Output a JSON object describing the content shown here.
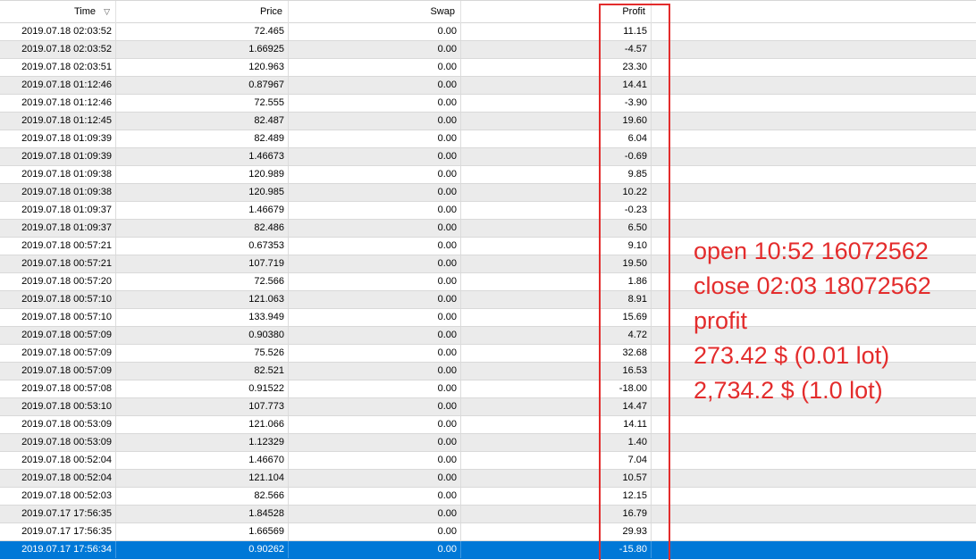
{
  "columns": {
    "time": "Time",
    "price": "Price",
    "swap": "Swap",
    "profit": "Profit",
    "sort_icon": "▽"
  },
  "rows": [
    {
      "time": "2019.07.18 02:03:52",
      "price": "72.465",
      "swap": "0.00",
      "profit": "11.15"
    },
    {
      "time": "2019.07.18 02:03:52",
      "price": "1.66925",
      "swap": "0.00",
      "profit": "-4.57"
    },
    {
      "time": "2019.07.18 02:03:51",
      "price": "120.963",
      "swap": "0.00",
      "profit": "23.30"
    },
    {
      "time": "2019.07.18 01:12:46",
      "price": "0.87967",
      "swap": "0.00",
      "profit": "14.41"
    },
    {
      "time": "2019.07.18 01:12:46",
      "price": "72.555",
      "swap": "0.00",
      "profit": "-3.90"
    },
    {
      "time": "2019.07.18 01:12:45",
      "price": "82.487",
      "swap": "0.00",
      "profit": "19.60"
    },
    {
      "time": "2019.07.18 01:09:39",
      "price": "82.489",
      "swap": "0.00",
      "profit": "6.04"
    },
    {
      "time": "2019.07.18 01:09:39",
      "price": "1.46673",
      "swap": "0.00",
      "profit": "-0.69"
    },
    {
      "time": "2019.07.18 01:09:38",
      "price": "120.989",
      "swap": "0.00",
      "profit": "9.85"
    },
    {
      "time": "2019.07.18 01:09:38",
      "price": "120.985",
      "swap": "0.00",
      "profit": "10.22"
    },
    {
      "time": "2019.07.18 01:09:37",
      "price": "1.46679",
      "swap": "0.00",
      "profit": "-0.23"
    },
    {
      "time": "2019.07.18 01:09:37",
      "price": "82.486",
      "swap": "0.00",
      "profit": "6.50"
    },
    {
      "time": "2019.07.18 00:57:21",
      "price": "0.67353",
      "swap": "0.00",
      "profit": "9.10"
    },
    {
      "time": "2019.07.18 00:57:21",
      "price": "107.719",
      "swap": "0.00",
      "profit": "19.50"
    },
    {
      "time": "2019.07.18 00:57:20",
      "price": "72.566",
      "swap": "0.00",
      "profit": "1.86"
    },
    {
      "time": "2019.07.18 00:57:10",
      "price": "121.063",
      "swap": "0.00",
      "profit": "8.91"
    },
    {
      "time": "2019.07.18 00:57:10",
      "price": "133.949",
      "swap": "0.00",
      "profit": "15.69"
    },
    {
      "time": "2019.07.18 00:57:09",
      "price": "0.90380",
      "swap": "0.00",
      "profit": "4.72"
    },
    {
      "time": "2019.07.18 00:57:09",
      "price": "75.526",
      "swap": "0.00",
      "profit": "32.68"
    },
    {
      "time": "2019.07.18 00:57:09",
      "price": "82.521",
      "swap": "0.00",
      "profit": "16.53"
    },
    {
      "time": "2019.07.18 00:57:08",
      "price": "0.91522",
      "swap": "0.00",
      "profit": "-18.00"
    },
    {
      "time": "2019.07.18 00:53:10",
      "price": "107.773",
      "swap": "0.00",
      "profit": "14.47"
    },
    {
      "time": "2019.07.18 00:53:09",
      "price": "121.066",
      "swap": "0.00",
      "profit": "14.11"
    },
    {
      "time": "2019.07.18 00:53:09",
      "price": "1.12329",
      "swap": "0.00",
      "profit": "1.40"
    },
    {
      "time": "2019.07.18 00:52:04",
      "price": "1.46670",
      "swap": "0.00",
      "profit": "7.04"
    },
    {
      "time": "2019.07.18 00:52:04",
      "price": "121.104",
      "swap": "0.00",
      "profit": "10.57"
    },
    {
      "time": "2019.07.18 00:52:03",
      "price": "82.566",
      "swap": "0.00",
      "profit": "12.15"
    },
    {
      "time": "2019.07.17 17:56:35",
      "price": "1.84528",
      "swap": "0.00",
      "profit": "16.79"
    },
    {
      "time": "2019.07.17 17:56:35",
      "price": "1.66569",
      "swap": "0.00",
      "profit": "29.93"
    },
    {
      "time": "2019.07.17 17:56:34",
      "price": "0.90262",
      "swap": "0.00",
      "profit": "-15.80",
      "selected": true
    }
  ],
  "note": {
    "line1": "open 10:52 16072562",
    "line2": "close 02:03 18072562",
    "line3": "profit",
    "line4": "273.42 $ (0.01 lot)",
    "line5": "2,734.2 $ (1.0 lot)"
  },
  "colors": {
    "annotation": "#e32c2c",
    "selection": "#0078d7",
    "alt_row": "#ebebeb"
  }
}
